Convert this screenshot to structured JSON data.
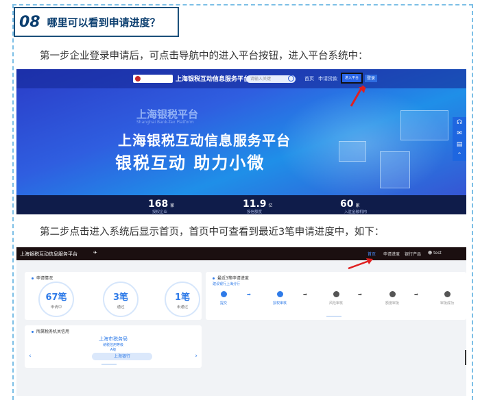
{
  "section": {
    "number": "08",
    "title": "哪里可以看到申请进度？"
  },
  "paragraphs": {
    "step1": "第一步企业登录申请后，可点击导航中的进入平台按钮，进入平台系统中：",
    "step2": "第二步点击进入系统后显示首页，首页中可查看到最近3笔申请进度中，如下："
  },
  "portal": {
    "brand": "上海银税互动信息服务平台",
    "search_placeholder": "请输入关键",
    "nav_home": "首页",
    "nav_loan": "申请贷款",
    "enter_button": "进入平台",
    "login_button": "登录",
    "hero_subtitle": "上海银税平台",
    "hero_subtitle_en": "Shanghai Bank-Tax Platform",
    "hero_title": "上海银税互动信息服务平台",
    "hero_slogan": "银税互动  助力小微",
    "stats": [
      {
        "value": "168",
        "unit": "家",
        "label": "授权企业"
      },
      {
        "value": "11.9",
        "unit": "亿",
        "label": "授信额度"
      },
      {
        "value": "60",
        "unit": "家",
        "label": "入驻金融机构"
      }
    ],
    "colors": {
      "accent": "#2965e8",
      "stat_bar": "#0f1c4a"
    }
  },
  "dashboard": {
    "brand": "上海银税互动信息服务平台",
    "nav": {
      "home": "首页",
      "progress": "申请进度",
      "products": "银行产品",
      "user": "test"
    },
    "application_card": {
      "title": "申请情况",
      "items": [
        {
          "value": "67笔",
          "label": "申请中"
        },
        {
          "value": "3笔",
          "label": "通过"
        },
        {
          "value": "1笔",
          "label": "未通过"
        }
      ]
    },
    "progress_card": {
      "title": "最近3笔申请进度",
      "bank": "建设银行上海分行",
      "steps": [
        "提交",
        "授权审核",
        "风险审核",
        "额度审批",
        "审批成功"
      ]
    },
    "rate_card": {
      "title": "所属税务机关信用",
      "office": "上海市税务局",
      "line1": "纳税信用等级",
      "line2": "A级",
      "button": "上海银行"
    },
    "colors": {
      "topbar": "#1b0f10",
      "accent": "#2f7be8"
    }
  }
}
